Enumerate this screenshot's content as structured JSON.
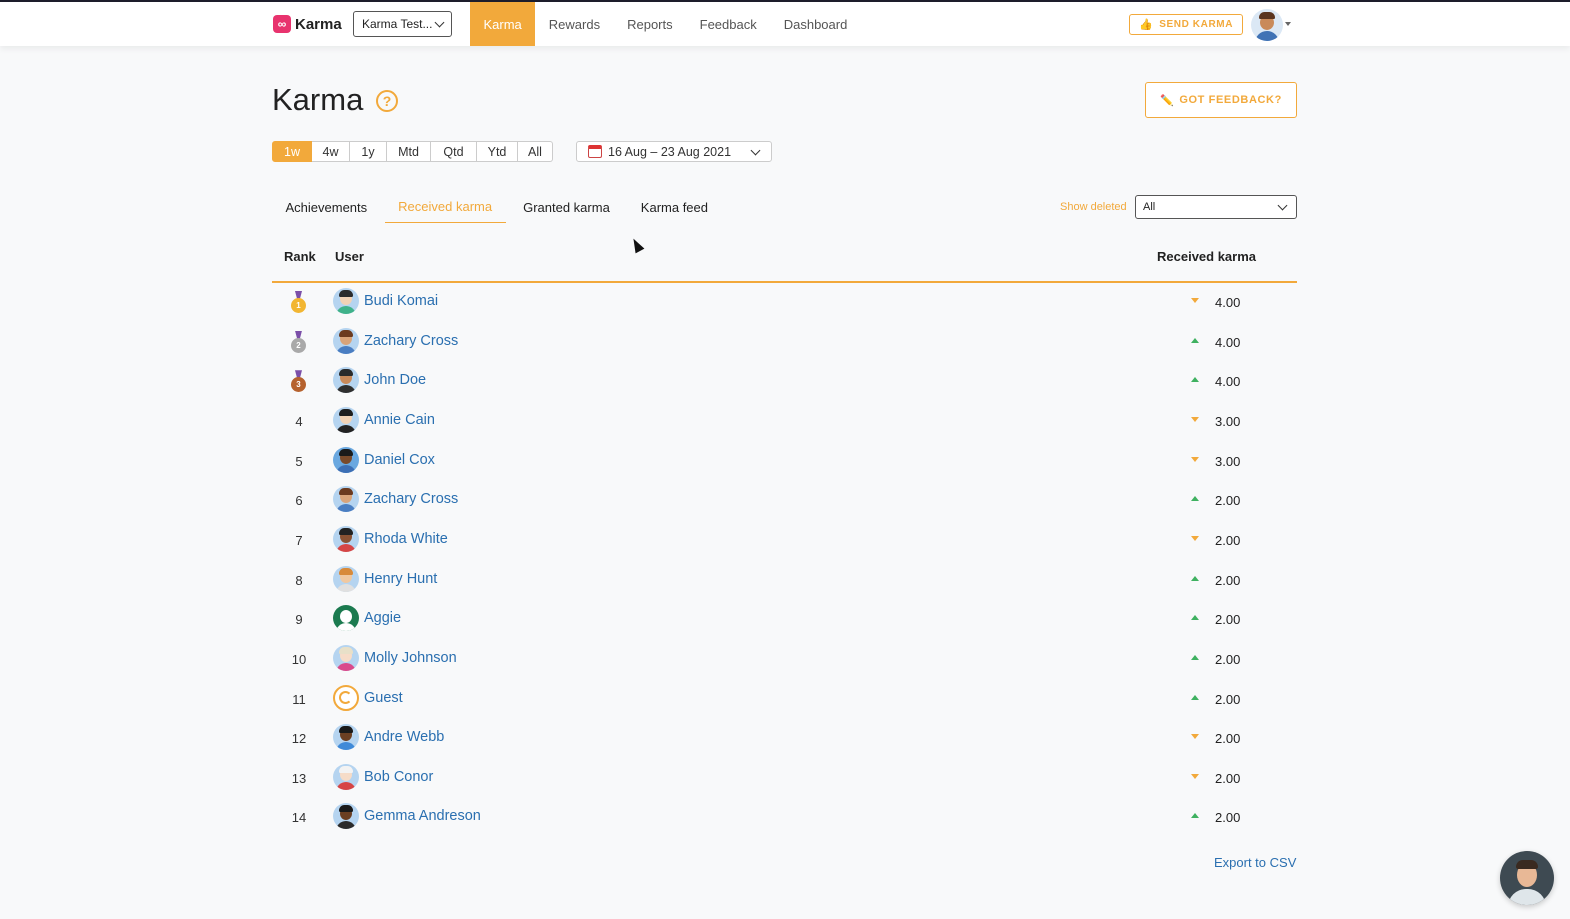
{
  "nav": {
    "logo_text": "Karma",
    "logo_mark": "∞",
    "team_select": "Karma Test...",
    "links": [
      "Karma",
      "Rewards",
      "Reports",
      "Feedback",
      "Dashboard"
    ],
    "active_link": "Karma",
    "send_karma": "SEND KARMA",
    "send_icon": "thumbs-up-icon"
  },
  "header": {
    "title": "Karma",
    "help_symbol": "?",
    "feedback_button": "GOT FEEDBACK?",
    "feedback_icon": "pencil-icon"
  },
  "periods": [
    "1w",
    "4w",
    "1y",
    "Mtd",
    "Qtd",
    "Ytd",
    "All"
  ],
  "active_period": "1w",
  "date_range": "16 Aug – 23 Aug 2021",
  "tabs": [
    "Achievements",
    "Received karma",
    "Granted karma",
    "Karma feed"
  ],
  "active_tab": "Received karma",
  "show_deleted": {
    "label": "Show deleted",
    "value": "All"
  },
  "table": {
    "headers": {
      "rank": "Rank",
      "user": "User",
      "karma": "Received karma"
    },
    "rows": [
      {
        "rank": "1",
        "medal": "gold",
        "name": "Budi Komai",
        "trend": "down",
        "karma": "4.00"
      },
      {
        "rank": "2",
        "medal": "silver",
        "name": "Zachary Cross",
        "trend": "up",
        "karma": "4.00"
      },
      {
        "rank": "3",
        "medal": "bronze",
        "name": "John Doe",
        "trend": "up",
        "karma": "4.00"
      },
      {
        "rank": "4",
        "name": "Annie Cain",
        "trend": "down",
        "karma": "3.00"
      },
      {
        "rank": "5",
        "name": "Daniel Cox",
        "trend": "down",
        "karma": "3.00"
      },
      {
        "rank": "6",
        "name": "Zachary Cross",
        "trend": "up",
        "karma": "2.00"
      },
      {
        "rank": "7",
        "name": "Rhoda White",
        "trend": "down",
        "karma": "2.00"
      },
      {
        "rank": "8",
        "name": "Henry Hunt",
        "trend": "up",
        "karma": "2.00"
      },
      {
        "rank": "9",
        "name": "Aggie",
        "trend": "up",
        "karma": "2.00"
      },
      {
        "rank": "10",
        "name": "Molly Johnson",
        "trend": "up",
        "karma": "2.00"
      },
      {
        "rank": "11",
        "name": "Guest",
        "trend": "up",
        "karma": "2.00"
      },
      {
        "rank": "12",
        "name": "Andre Webb",
        "trend": "down",
        "karma": "2.00"
      },
      {
        "rank": "13",
        "name": "Bob Conor",
        "trend": "down",
        "karma": "2.00"
      },
      {
        "rank": "14",
        "name": "Gemma Andreson",
        "trend": "up",
        "karma": "2.00"
      }
    ]
  },
  "export_link": "Export to CSV",
  "colors": {
    "accent": "#f2a93b",
    "link": "#2a6fb0",
    "up": "#3fb160",
    "logo": "#e8336e"
  }
}
